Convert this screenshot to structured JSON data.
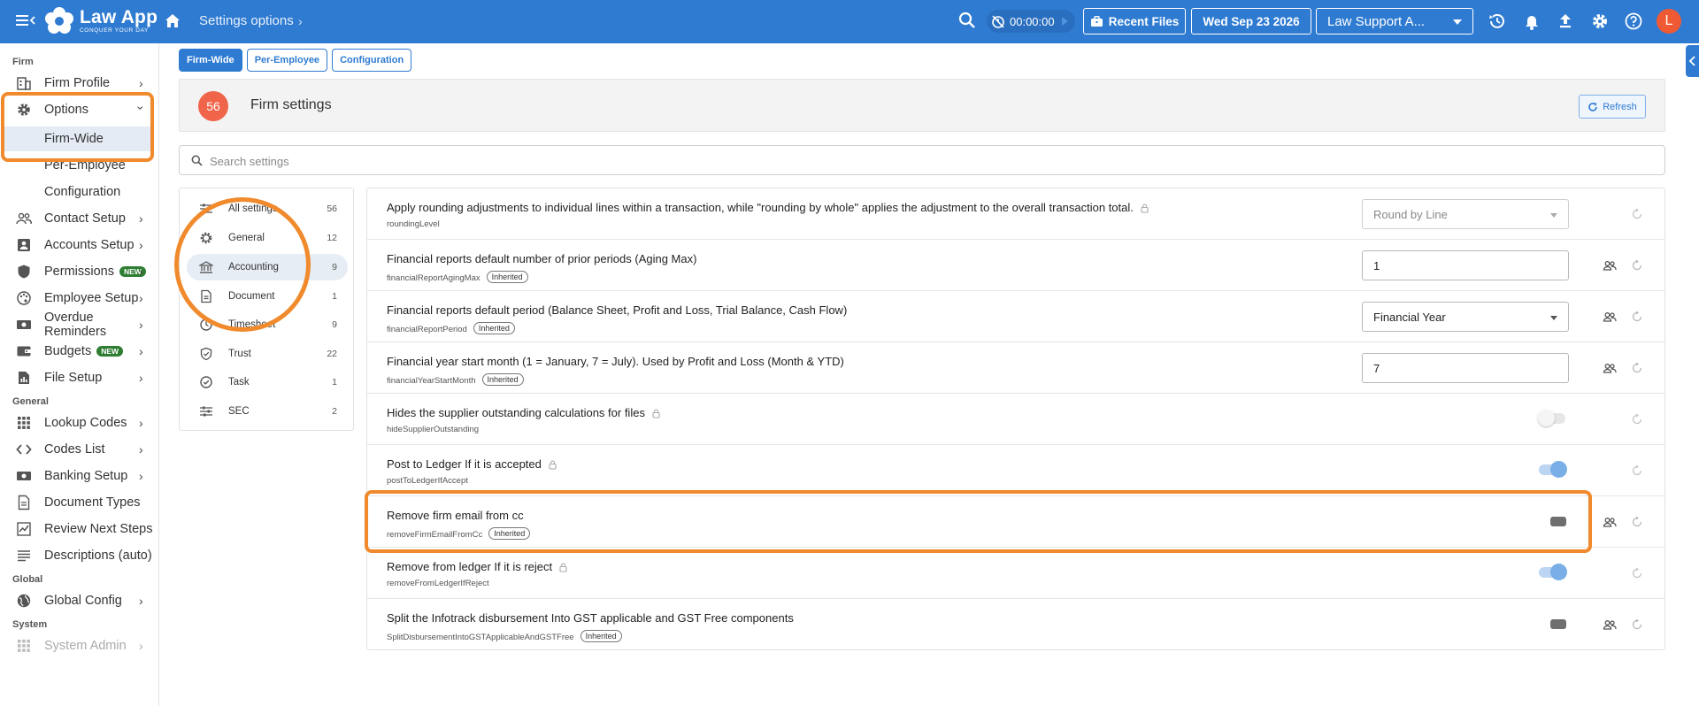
{
  "topbar": {
    "app_title": "Law App",
    "app_tagline": "CONQUER YOUR DAY",
    "breadcrumb": "Settings options",
    "timer": "00:00:00",
    "recent_files": "Recent Files",
    "date": "Wed Sep 23 2026",
    "role_select": "Law Support A...",
    "avatar_initial": "L"
  },
  "sidebar": {
    "sections": {
      "firm": "Firm",
      "general": "General",
      "global": "Global",
      "system": "System"
    },
    "items": {
      "firm_profile": "Firm Profile",
      "options": "Options",
      "firm_wide": "Firm-Wide",
      "per_employee": "Per-Employee",
      "configuration": "Configuration",
      "contact_setup": "Contact Setup",
      "accounts_setup": "Accounts Setup",
      "permissions": "Permissions",
      "employee_setup": "Employee Setup",
      "overdue_reminders": "Overdue Reminders",
      "budgets": "Budgets",
      "file_setup": "File Setup",
      "lookup_codes": "Lookup Codes",
      "codes_list": "Codes List",
      "banking_setup": "Banking Setup",
      "document_types": "Document Types",
      "review_next_steps": "Review Next Steps",
      "descriptions_auto": "Descriptions (auto)",
      "global_config": "Global Config",
      "system_admin": "System Admin"
    },
    "new_badge": "NEW"
  },
  "tabs": [
    "Firm-Wide",
    "Per-Employee",
    "Configuration"
  ],
  "header": {
    "count": "56",
    "title": "Firm settings",
    "refresh": "Refresh"
  },
  "search": {
    "placeholder": "Search settings",
    "value": ""
  },
  "categories": [
    {
      "label": "All settings",
      "count": "56",
      "icon": "sliders-icon"
    },
    {
      "label": "General",
      "count": "12",
      "icon": "gear-icon"
    },
    {
      "label": "Accounting",
      "count": "9",
      "icon": "bank-icon"
    },
    {
      "label": "Document",
      "count": "1",
      "icon": "document-icon"
    },
    {
      "label": "Timesheet",
      "count": "9",
      "icon": "clock-icon"
    },
    {
      "label": "Trust",
      "count": "22",
      "icon": "shield-check-icon"
    },
    {
      "label": "Task",
      "count": "1",
      "icon": "check-circle-icon"
    },
    {
      "label": "SEC",
      "count": "2",
      "icon": "sliders-icon"
    }
  ],
  "inherited_label": "Inherited",
  "settings": [
    {
      "title": "Apply rounding adjustments to individual lines within a transaction, while \"rounding by whole\" applies the adjustment to the overall transaction total.",
      "key": "roundingLevel",
      "value": "Round by Line"
    },
    {
      "title": "Financial reports default number of prior periods (Aging Max)",
      "key": "financialReportAgingMax",
      "value": "1"
    },
    {
      "title": "Financial reports default period (Balance Sheet, Profit and Loss, Trial Balance, Cash Flow)",
      "key": "financialReportPeriod",
      "value": "Financial Year"
    },
    {
      "title": "Financial year start month (1 = January, 7 = July). Used by Profit and Loss (Month & YTD)",
      "key": "financialYearStartMonth",
      "value": "7"
    },
    {
      "title": "Hides the supplier outstanding calculations for files",
      "key": "hideSupplierOutstanding",
      "value": "off"
    },
    {
      "title": "Post to Ledger If it is accepted",
      "key": "postToLedgerIfAccept",
      "value": "on"
    },
    {
      "title": "Remove firm email from cc",
      "key": "removeFirmEmailFromCc",
      "value": "off"
    },
    {
      "title": "Remove from ledger If it is reject",
      "key": "removeFromLedgerIfReject",
      "value": "on"
    },
    {
      "title": "Split the Infotrack disbursement Into GST applicable and GST Free components",
      "key": "SplitDisbursementIntoGSTApplicableAndGSTFree",
      "value": "off"
    }
  ],
  "colors": {
    "brand": "#2f7bd1",
    "highlight": "#f08a2c",
    "count_badge": "#f0654a",
    "new_badge": "#2e7d32"
  }
}
